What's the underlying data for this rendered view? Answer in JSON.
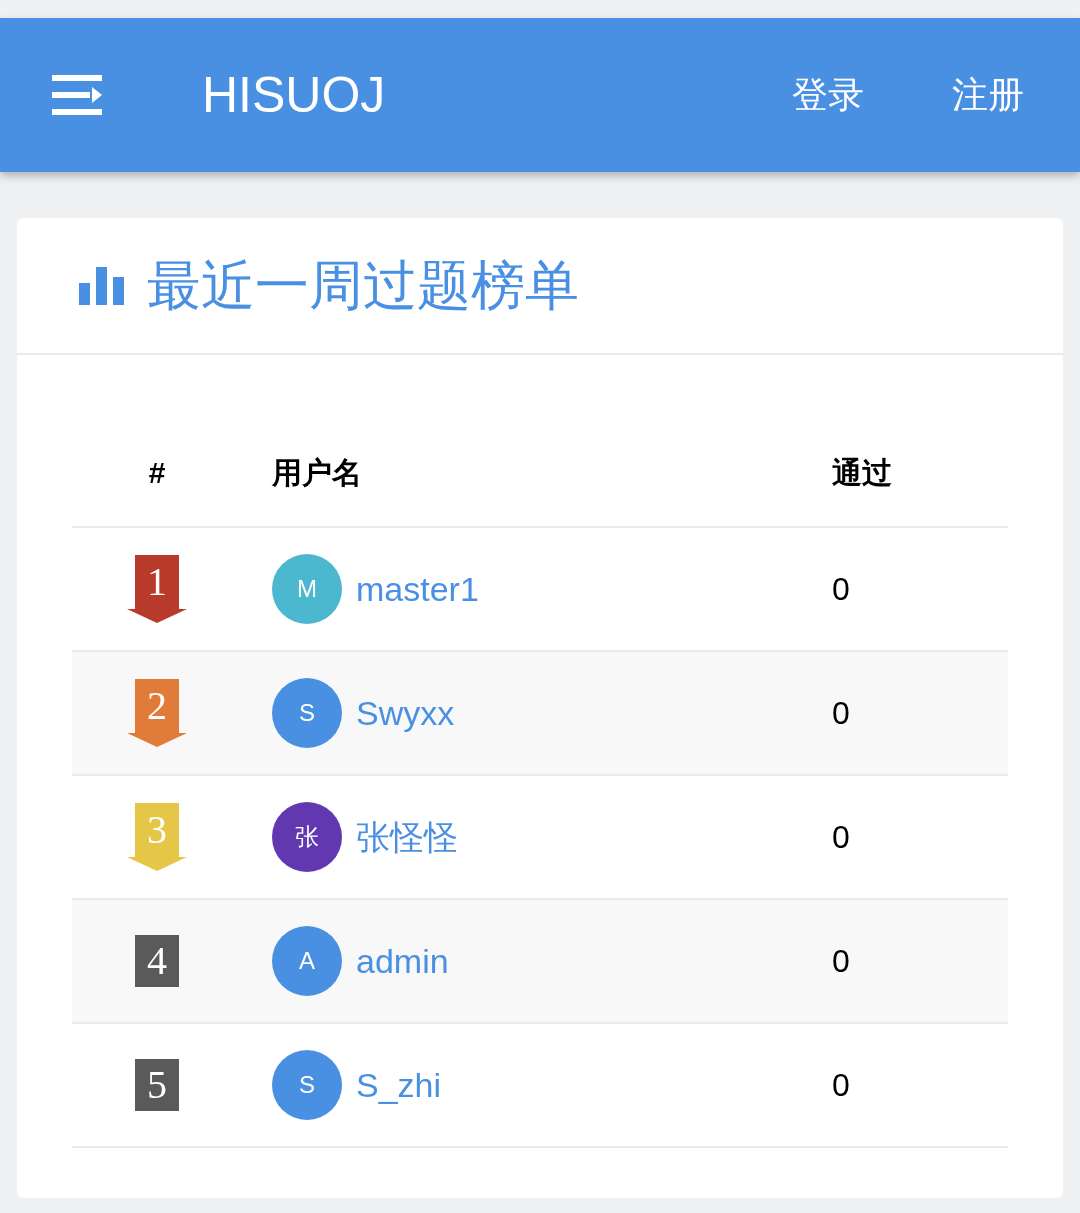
{
  "header": {
    "title": "HISUOJ",
    "links": [
      "登录",
      "注册"
    ]
  },
  "card": {
    "title": "最近一周过题榜单"
  },
  "table": {
    "columns": [
      "#",
      "用户名",
      "通过"
    ],
    "rows": [
      {
        "rank": {
          "text": "1",
          "kind": "ribbon",
          "color": "#b83a2b"
        },
        "avatar": {
          "text": "M",
          "color": "#4cb8cf"
        },
        "user": "master1",
        "solved": "0"
      },
      {
        "rank": {
          "text": "2",
          "kind": "ribbon",
          "color": "#e07b39"
        },
        "avatar": {
          "text": "S",
          "color": "#4a90e2"
        },
        "user": "Swyxx",
        "solved": "0"
      },
      {
        "rank": {
          "text": "3",
          "kind": "ribbon",
          "color": "#e6c647"
        },
        "avatar": {
          "text": "张",
          "color": "#6238b0"
        },
        "user": "张怪怪",
        "solved": "0"
      },
      {
        "rank": {
          "text": "4",
          "kind": "plain",
          "color": "#5a5a5a"
        },
        "avatar": {
          "text": "A",
          "color": "#4a90e2"
        },
        "user": "admin",
        "solved": "0"
      },
      {
        "rank": {
          "text": "5",
          "kind": "plain",
          "color": "#5a5a5a"
        },
        "avatar": {
          "text": "S",
          "color": "#4a90e2"
        },
        "user": "S_zhi",
        "solved": "0"
      }
    ]
  }
}
